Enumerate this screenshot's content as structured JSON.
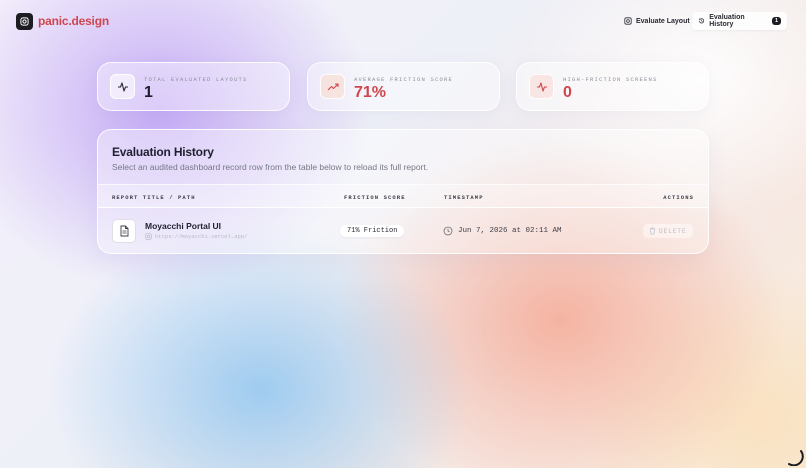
{
  "header": {
    "brand": "panic.design",
    "evaluate_label": "Evaluate Layout",
    "history_label": "Evaluation History",
    "history_count": "1"
  },
  "stats": [
    {
      "label": "TOTAL EVALUATED LAYOUTS",
      "value": "1",
      "icon": "activity-icon"
    },
    {
      "label": "AVERAGE FRICTION SCORE",
      "value": "71%",
      "icon": "trending-up-icon"
    },
    {
      "label": "HIGH-FRICTION SCREENS",
      "value": "0",
      "icon": "activity-icon"
    }
  ],
  "history": {
    "title": "Evaluation History",
    "subtitle": "Select an audited dashboard record row from the table below to reload its full report.",
    "columns": [
      "REPORT TITLE / PATH",
      "FRICTION SCORE",
      "TIMESTAMP",
      "ACTIONS"
    ],
    "rows": [
      {
        "title": "Moyacchi Portal UI",
        "url": "https://moyacchi.vercel.app/",
        "score": "71% Friction",
        "timestamp": "Jun 7, 2026 at 02:11 AM",
        "action": "DELETE"
      }
    ]
  },
  "colors": {
    "accent": "#d0464f",
    "dark": "#1c1c22"
  }
}
